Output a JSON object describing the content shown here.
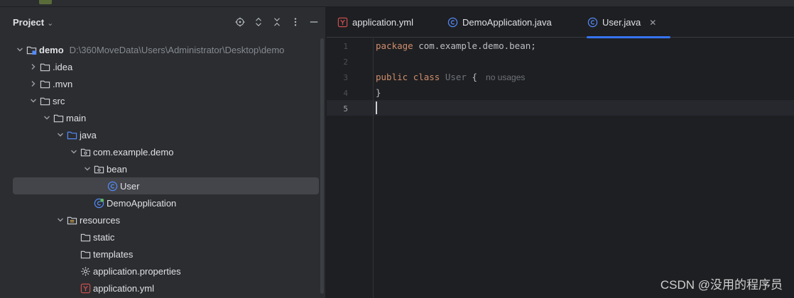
{
  "panel": {
    "title": "Project"
  },
  "tree": [
    {
      "depth": 0,
      "arrow": "down",
      "icon": "module",
      "label": "demo",
      "bold": true,
      "path": "D:\\360MoveData\\Users\\Administrator\\Desktop\\demo"
    },
    {
      "depth": 1,
      "arrow": "right",
      "icon": "folder",
      "label": ".idea"
    },
    {
      "depth": 1,
      "arrow": "right",
      "icon": "folder",
      "label": ".mvn"
    },
    {
      "depth": 1,
      "arrow": "down",
      "icon": "folder",
      "label": "src"
    },
    {
      "depth": 2,
      "arrow": "down",
      "icon": "folder",
      "label": "main"
    },
    {
      "depth": 3,
      "arrow": "down",
      "icon": "source-folder",
      "label": "java"
    },
    {
      "depth": 4,
      "arrow": "down",
      "icon": "package",
      "label": "com.example.demo"
    },
    {
      "depth": 5,
      "arrow": "down",
      "icon": "package",
      "label": "bean"
    },
    {
      "depth": 6,
      "arrow": "none",
      "icon": "class",
      "label": "User",
      "selected": true
    },
    {
      "depth": 5,
      "arrow": "none",
      "icon": "spring-class",
      "label": "DemoApplication"
    },
    {
      "depth": 3,
      "arrow": "down",
      "icon": "resources-folder",
      "label": "resources"
    },
    {
      "depth": 4,
      "arrow": "none",
      "icon": "folder",
      "label": "static"
    },
    {
      "depth": 4,
      "arrow": "none",
      "icon": "folder",
      "label": "templates"
    },
    {
      "depth": 4,
      "arrow": "none",
      "icon": "gear",
      "label": "application.properties"
    },
    {
      "depth": 4,
      "arrow": "none",
      "icon": "yaml",
      "label": "application.yml"
    }
  ],
  "tabs": [
    {
      "icon": "yaml",
      "label": "application.yml"
    },
    {
      "icon": "class",
      "label": "DemoApplication.java"
    },
    {
      "icon": "class",
      "label": "User.java",
      "active": true
    }
  ],
  "editor": {
    "line_numbers": [
      "1",
      "2",
      "3",
      "4",
      "5"
    ],
    "lines": [
      [
        {
          "t": "package",
          "c": "kw"
        },
        {
          "t": " com.example.demo.bean;"
        }
      ],
      [],
      [
        {
          "t": "public",
          "c": "kw"
        },
        {
          "t": " "
        },
        {
          "t": "class",
          "c": "kw"
        },
        {
          "t": " "
        },
        {
          "t": "User",
          "c": "cls"
        },
        {
          "t": " {"
        },
        {
          "t": "no usages",
          "c": "hint"
        }
      ],
      [
        {
          "t": "}"
        }
      ],
      []
    ],
    "current_line": 5
  },
  "watermark": "CSDN @没用的程序员",
  "colors": {
    "accent": "#3574f0",
    "keyword": "#cf8e6d",
    "class_icon": "#548af7",
    "yaml_icon": "#c94f4f"
  }
}
